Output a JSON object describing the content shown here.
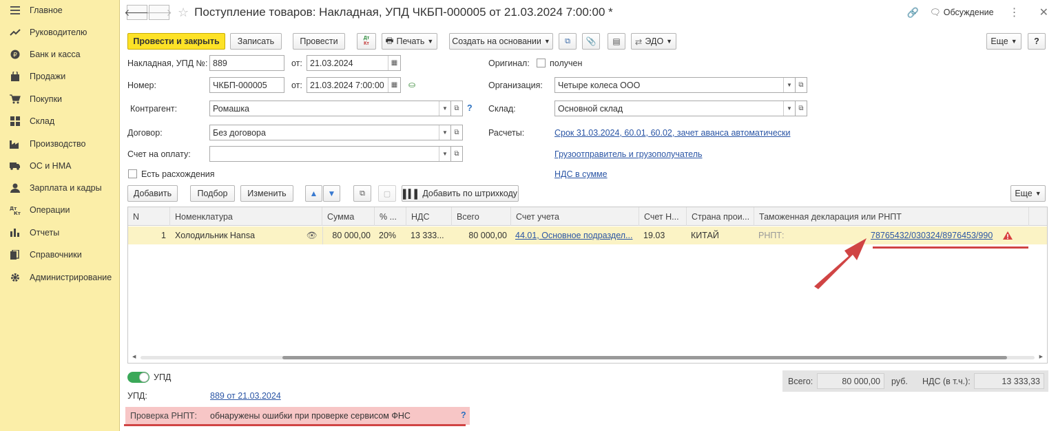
{
  "sidebar": {
    "items": [
      {
        "label": "Главное",
        "icon": "menu-icon"
      },
      {
        "label": "Руководителю",
        "icon": "trend-icon"
      },
      {
        "label": "Банк и касса",
        "icon": "ruble-coin-icon"
      },
      {
        "label": "Продажи",
        "icon": "shopping-bag-icon"
      },
      {
        "label": "Покупки",
        "icon": "cart-icon"
      },
      {
        "label": "Склад",
        "icon": "warehouse-icon"
      },
      {
        "label": "Производство",
        "icon": "factory-icon"
      },
      {
        "label": "ОС и НМА",
        "icon": "truck-icon"
      },
      {
        "label": "Зарплата и кадры",
        "icon": "person-icon"
      },
      {
        "label": "Операции",
        "icon": "debit-credit-icon"
      },
      {
        "label": "Отчеты",
        "icon": "bar-chart-icon"
      },
      {
        "label": "Справочники",
        "icon": "books-icon"
      },
      {
        "label": "Администрирование",
        "icon": "gear-icon"
      }
    ]
  },
  "header": {
    "title": "Поступление товаров: Накладная, УПД ЧКБП-000005 от 21.03.2024 7:00:00 *",
    "discussion": "Обсуждение"
  },
  "toolbar": {
    "post_close": "Провести и закрыть",
    "save": "Записать",
    "post": "Провести",
    "print": "Печать",
    "create_based": "Создать на основании",
    "edo": "ЭДО",
    "more": "Еще",
    "help": "?"
  },
  "form": {
    "invoice_label": "Накладная, УПД №:",
    "invoice_value": "889",
    "from_label": "от:",
    "invoice_date": "21.03.2024",
    "number_label": "Номер:",
    "number_value": "ЧКБП-000005",
    "number_date": "21.03.2024  7:00:00",
    "counterparty_label": "Контрагент:",
    "counterparty_value": "Ромашка",
    "contract_label": "Договор:",
    "contract_value": "Без договора",
    "payment_label": "Счет на оплату:",
    "payment_value": "",
    "discrepancy_label": "Есть расхождения",
    "original_label": "Оригинал:",
    "original_check": "получен",
    "org_label": "Организация:",
    "org_value": "Четыре колеса ООО",
    "warehouse_label": "Склад:",
    "warehouse_value": "Основной склад",
    "settlements_label": "Расчеты:",
    "settlements_link": "Срок 31.03.2024, 60.01, 60.02, зачет аванса автоматически",
    "shipper_link": "Грузоотправитель и грузополучатель",
    "vat_link": "НДС в сумме",
    "help_q": "?"
  },
  "table_toolbar": {
    "add": "Добавить",
    "select": "Подбор",
    "change": "Изменить",
    "barcode": "Добавить по штрихкоду",
    "more": "Еще"
  },
  "table": {
    "columns": [
      "N",
      "Номенклатура",
      "Сумма",
      "% ...",
      "НДС",
      "Всего",
      "Счет учета",
      "Счет Н...",
      "Страна прои...",
      "Таможенная декларация или РНПТ"
    ],
    "rows": [
      {
        "n": "1",
        "item": "Холодильник Hansa",
        "sum": "80 000,00",
        "vat_rate": "20%",
        "vat": "13 333...",
        "total": "80 000,00",
        "account": "44.01, Основное подраздел...",
        "vat_account": "19.03",
        "country": "КИТАЙ",
        "rnpt_label": "РНПТ:",
        "rnpt_value": "78765432/030324/8976453/990"
      }
    ]
  },
  "footer": {
    "upd_toggle": "УПД",
    "upd_label": "УПД:",
    "upd_link": "889 от 21.03.2024",
    "total_label": "Всего:",
    "total_value": "80 000,00",
    "currency": "руб.",
    "vat_label": "НДС (в т.ч.):",
    "vat_value": "13 333,33",
    "rnpt_check_label": "Проверка РНПТ:",
    "rnpt_check_value": "обнаружены ошибки при проверке сервисом ФНС",
    "help_q": "?"
  },
  "colors": {
    "sidebar_bg": "#fbeea8",
    "primary_button": "#fde227",
    "selected_row": "#fbf3c5",
    "link": "#2a55a5",
    "annotation_red": "#d04444",
    "error_bg": "#f7c6c6"
  }
}
